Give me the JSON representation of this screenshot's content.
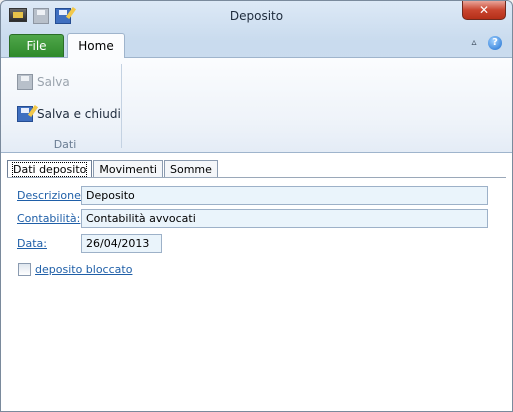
{
  "window": {
    "title": "Deposito",
    "close_glyph": "✕",
    "quick_access": [
      {
        "icon": "app-icon"
      },
      {
        "icon": "save-icon"
      },
      {
        "icon": "save-close-icon"
      }
    ]
  },
  "ribbon": {
    "file_tab": "File",
    "home_tab": "Home",
    "collapse_glyph": "▵",
    "help_glyph": "?",
    "group_label": "Dati",
    "buttons": {
      "salva": "Salva",
      "salva_chiudi": "Salva e chiudi"
    }
  },
  "content": {
    "tabs": [
      "Dati deposito",
      "Movimenti",
      "Somme"
    ],
    "active_tab": "Dati deposito",
    "fields": {
      "descrizione_label": "Descrizione:",
      "descrizione_value": "Deposito",
      "contabilita_label": "Contabilità:",
      "contabilita_value": "Contabilità avvocati",
      "data_label": "Data:",
      "data_value": "26/04/2013"
    },
    "checkbox": {
      "label": "deposito bloccato",
      "checked": false
    }
  },
  "colors": {
    "file_tab": "#2f8a2b",
    "label_link": "#1f5fa8",
    "field_bg": "#eaf4fb",
    "close_button": "#c9452f"
  }
}
